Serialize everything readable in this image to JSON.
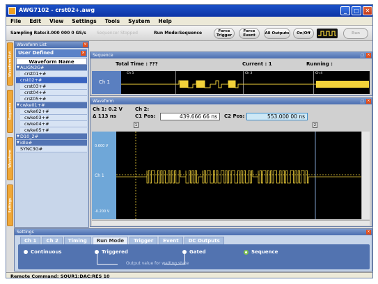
{
  "window": {
    "title": "AWG7102 - crst02+.awg"
  },
  "menu": [
    "File",
    "Edit",
    "View",
    "Settings",
    "Tools",
    "System",
    "Help"
  ],
  "toolbar": {
    "sampling_rate": "Sampling Rate:3.000 000 0 GS/s",
    "sequencer_status": "Sequencer Stopped",
    "run_mode": "Run Mode:Sequence",
    "force_trigger": [
      "Force",
      "Trigger"
    ],
    "force_event": [
      "Force",
      "Event"
    ],
    "all_outputs": "All Outputs",
    "on_off": "On/Off",
    "run": "Run"
  },
  "side_tabs": [
    "Waveform List",
    "Sequence",
    "Waveform",
    "Settings"
  ],
  "waveform_list": {
    "header": "Waveform List",
    "tab": "User Defined",
    "column": "Waveform Name",
    "rows": [
      {
        "name": "ALIGN3G#",
        "kind": "group"
      },
      {
        "name": "crst01+#",
        "kind": "child"
      },
      {
        "name": "crst02+#",
        "kind": "sel"
      },
      {
        "name": "crst03+#",
        "kind": "child"
      },
      {
        "name": "crst04+#",
        "kind": "child"
      },
      {
        "name": "crst05+#",
        "kind": "child"
      },
      {
        "name": "cwke01+#",
        "kind": "group"
      },
      {
        "name": "cwke02+#",
        "kind": "child"
      },
      {
        "name": "cwke03+#",
        "kind": "child"
      },
      {
        "name": "cwke04+#",
        "kind": "child"
      },
      {
        "name": "cwke05+#",
        "kind": "child"
      },
      {
        "name": "D10_2#",
        "kind": "group"
      },
      {
        "name": "idle#",
        "kind": "group"
      },
      {
        "name": "SYNC3G#",
        "kind": "plain"
      }
    ]
  },
  "sequence": {
    "header": "Sequence",
    "total_time": "Total Time : ???",
    "current": "Current : 1",
    "running": "Running :",
    "channel": "Ch 1",
    "markers": [
      "Ch 5",
      "Ch 3",
      "Ch 4"
    ]
  },
  "waveform": {
    "header": "Waveform",
    "ch1_scale": "Ch 1: 0.2 V",
    "delta_time": "Δ 113 ns",
    "ch2": "Ch 2:",
    "c1_label": "C1 Pos:",
    "c1_value": "439.666 66 ns",
    "c2_label": "C2 Pos:",
    "c2_value": "553.000 00 ns",
    "y_top": "0.600 V",
    "y_bottom": "-0.200 V",
    "channel": "Ch 1",
    "cursor1": "1",
    "cursor2": "2"
  },
  "settings": {
    "header": "Settings",
    "tabs": [
      "Ch 1",
      "Ch 2",
      "Timing",
      "Run Mode",
      "Trigger",
      "Event",
      "DC Outputs"
    ],
    "active_tab": "Run Mode",
    "options": [
      "Continuous",
      "Triggered",
      "Gated",
      "Sequence"
    ],
    "selected": "Sequence",
    "note": "Output value for waiting state"
  },
  "status": {
    "text": "Remote Command: SOUR1:DAC:RES 10"
  },
  "colors": {
    "trace": "#f2d23a",
    "plot_bg": "#000000",
    "accent": "#5273b0",
    "side_tab": "#f0a838"
  }
}
